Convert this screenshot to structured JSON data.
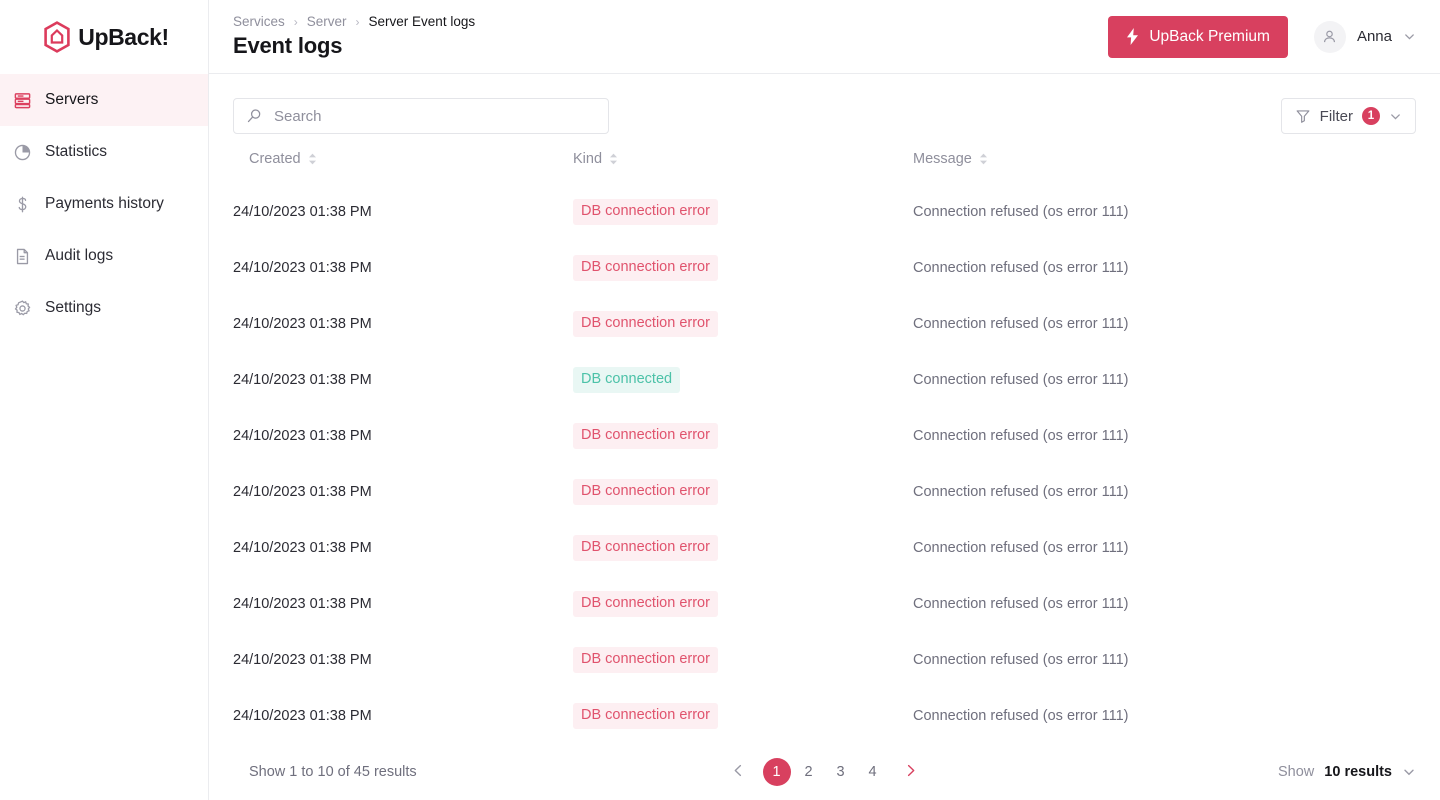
{
  "brand": {
    "logo_icon": "upback-hexagon-icon",
    "name": "UpBack!",
    "accent_color": "#D8405F",
    "accent_soft_bg": "#FDF2F4"
  },
  "sidebar": {
    "items": [
      {
        "label": "Servers",
        "icon": "server-rack-icon",
        "active": true
      },
      {
        "label": "Statistics",
        "icon": "pie-chart-icon",
        "active": false
      },
      {
        "label": "Payments history",
        "icon": "dollar-icon",
        "active": false
      },
      {
        "label": "Audit logs",
        "icon": "document-icon",
        "active": false
      },
      {
        "label": "Settings",
        "icon": "gear-icon",
        "active": false
      }
    ]
  },
  "header": {
    "breadcrumb": [
      "Services",
      "Server",
      "Server Event logs"
    ],
    "separator": "›",
    "title": "Event logs",
    "premium_button": {
      "label": "UpBack Premium",
      "icon": "lightning-bolt-icon"
    },
    "user": {
      "name": "Anna",
      "avatar_icon": "person-icon",
      "chevron_icon": "chevron-down-icon"
    }
  },
  "toolbar": {
    "search": {
      "placeholder": "Search",
      "value": "",
      "icon": "search-icon"
    },
    "filter": {
      "label": "Filter",
      "count": "1",
      "icon": "funnel-icon",
      "chevron_icon": "chevron-down-icon"
    }
  },
  "table": {
    "columns": [
      {
        "label": "Created",
        "sort_icon": "sort-updown-icon"
      },
      {
        "label": "Kind",
        "sort_icon": "sort-updown-icon"
      },
      {
        "label": "Message",
        "sort_icon": "sort-updown-icon"
      }
    ],
    "rows": [
      {
        "created": "24/10/2023 01:38 PM",
        "kind": "DB connection error",
        "kind_state": "error",
        "message": "Connection refused (os error 111)"
      },
      {
        "created": "24/10/2023 01:38 PM",
        "kind": "DB connection error",
        "kind_state": "error",
        "message": "Connection refused (os error 111)"
      },
      {
        "created": "24/10/2023 01:38 PM",
        "kind": "DB connection error",
        "kind_state": "error",
        "message": "Connection refused (os error 111)"
      },
      {
        "created": "24/10/2023 01:38 PM",
        "kind": "DB connected",
        "kind_state": "ok",
        "message": "Connection refused (os error 111)"
      },
      {
        "created": "24/10/2023 01:38 PM",
        "kind": "DB connection error",
        "kind_state": "error",
        "message": "Connection refused (os error 111)"
      },
      {
        "created": "24/10/2023 01:38 PM",
        "kind": "DB connection error",
        "kind_state": "error",
        "message": "Connection refused (os error 111)"
      },
      {
        "created": "24/10/2023 01:38 PM",
        "kind": "DB connection error",
        "kind_state": "error",
        "message": "Connection refused (os error 111)"
      },
      {
        "created": "24/10/2023 01:38 PM",
        "kind": "DB connection error",
        "kind_state": "error",
        "message": "Connection refused (os error 111)"
      },
      {
        "created": "24/10/2023 01:38 PM",
        "kind": "DB connection error",
        "kind_state": "error",
        "message": "Connection refused (os error 111)"
      },
      {
        "created": "24/10/2023 01:38 PM",
        "kind": "DB connection error",
        "kind_state": "error",
        "message": "Connection refused (os error 111)"
      }
    ]
  },
  "pagination": {
    "result_text": "Show 1 to 10 of 45 results",
    "prev_icon": "chevron-left-icon",
    "next_icon": "chevron-right-icon",
    "pages": [
      "1",
      "2",
      "3",
      "4"
    ],
    "active_page": "1",
    "per_page_label": "Show",
    "per_page_value": "10 results",
    "per_page_chevron": "chevron-down-icon"
  }
}
